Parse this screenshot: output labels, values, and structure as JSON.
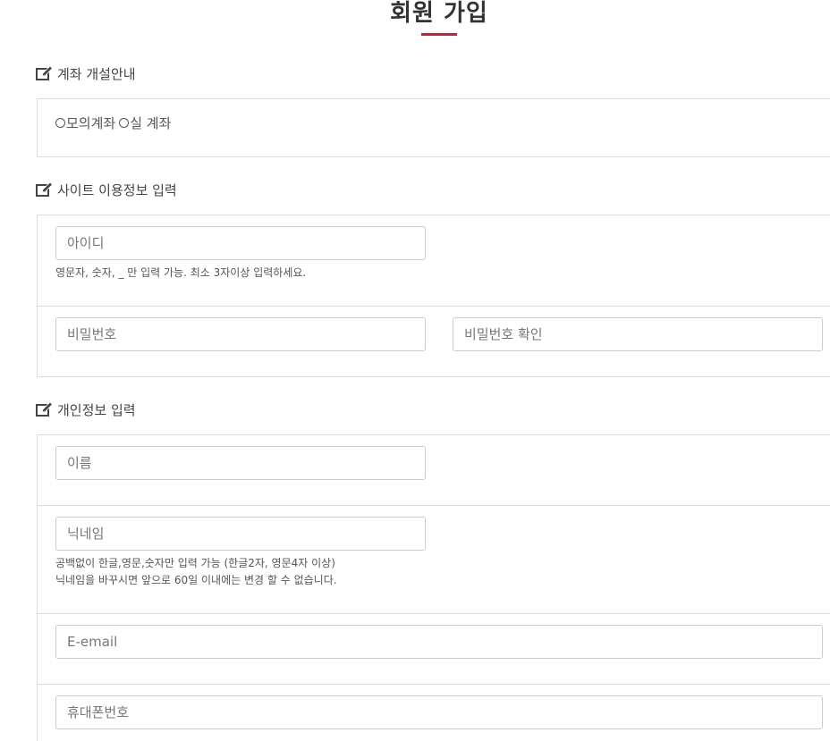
{
  "page": {
    "title": "회원 가입"
  },
  "sections": {
    "account": {
      "heading": "계좌 개설안내",
      "options": [
        "모의계좌",
        "실 계좌"
      ]
    },
    "site_info": {
      "heading": "사이트 이용정보 입력",
      "id_placeholder": "아이디",
      "id_help": "영문자, 숫자, _ 만 입력 가능. 최소 3자이상 입력하세요.",
      "password_placeholder": "비밀번호",
      "password_confirm_placeholder": "비밀번호 확인"
    },
    "personal_info": {
      "heading": "개인정보 입력",
      "name_placeholder": "이름",
      "nickname_placeholder": "닉네임",
      "nickname_help_1": "공백없이 한글,영문,숫자만 입력 가능 (한글2자, 영문4자 이상)",
      "nickname_help_2": "닉네임을 바꾸시면 앞으로 60일 이내에는 변경 할 수 없습니다.",
      "email_placeholder": "E-email",
      "phone_placeholder": "휴대폰번호"
    }
  },
  "colors": {
    "accent": "#c0243a",
    "border": "#dddddd",
    "input_border": "#cccccc",
    "text": "#555555"
  },
  "icons": {
    "section_heading_icon": "edit-icon"
  }
}
